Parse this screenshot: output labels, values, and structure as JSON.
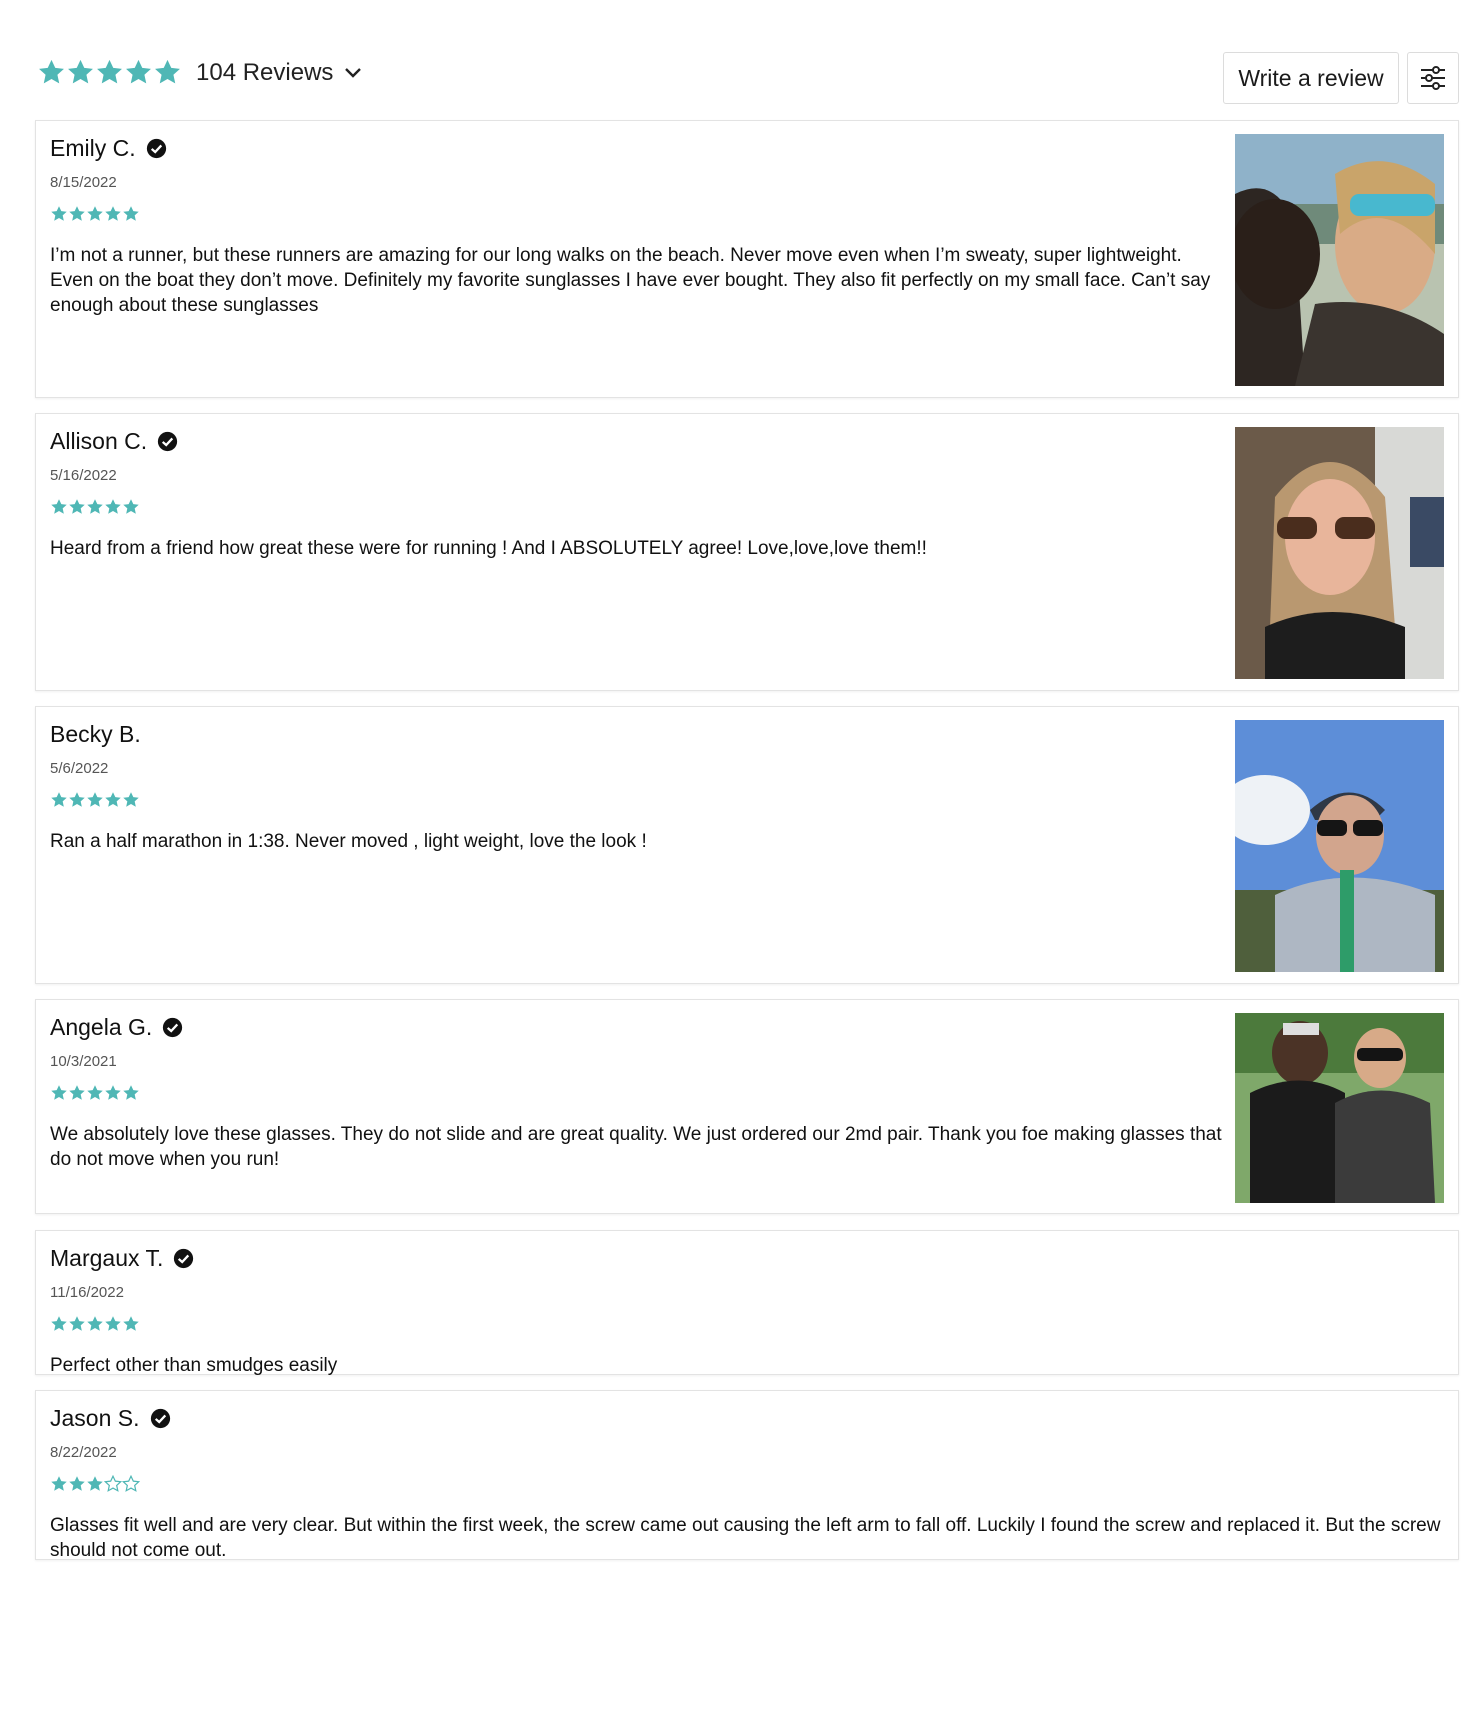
{
  "summary": {
    "rating": 5,
    "count_label": "104 Reviews",
    "star_color": "#4fb7b5"
  },
  "actions": {
    "write_review_label": "Write a review"
  },
  "reviews": [
    {
      "name": "Emily C.",
      "verified": true,
      "date": "8/15/2022",
      "rating": 5,
      "body": "I’m not a runner, but these runners are amazing for our long walks on the beach. Never move even when I’m sweaty, super lightweight. Even on the boat they don’t move. Definitely my favorite sunglasses I have ever bought. They also fit perfectly on my small face. Can’t say enough about these sunglasses",
      "has_photo": true
    },
    {
      "name": "Allison C.",
      "verified": true,
      "date": "5/16/2022",
      "rating": 5,
      "body": "Heard from a friend how great these were for running ! And I ABSOLUTELY agree!  Love,love,love them!!",
      "has_photo": true
    },
    {
      "name": "Becky B.",
      "verified": false,
      "date": "5/6/2022",
      "rating": 5,
      "body": "Ran a half marathon in 1:38. Never moved , light weight, love the look !",
      "has_photo": true
    },
    {
      "name": "Angela G.",
      "verified": true,
      "date": "10/3/2021",
      "rating": 5,
      "body": "We absolutely love these glasses. They do not slide and are great quality. We just ordered our 2md pair. Thank you foe making glasses that do not move when you run!",
      "has_photo": true
    },
    {
      "name": "Margaux T.",
      "verified": true,
      "date": "11/16/2022",
      "rating": 5,
      "body": "Perfect other than smudges easily",
      "has_photo": false
    },
    {
      "name": "Jason S.",
      "verified": true,
      "date": "8/22/2022",
      "rating": 3,
      "body": "Glasses fit well and are very clear. But within the first week, the screw came out causing the left arm to fall off. Luckily I found the screw and replaced it. But the screw should not come out.",
      "has_photo": false
    }
  ]
}
